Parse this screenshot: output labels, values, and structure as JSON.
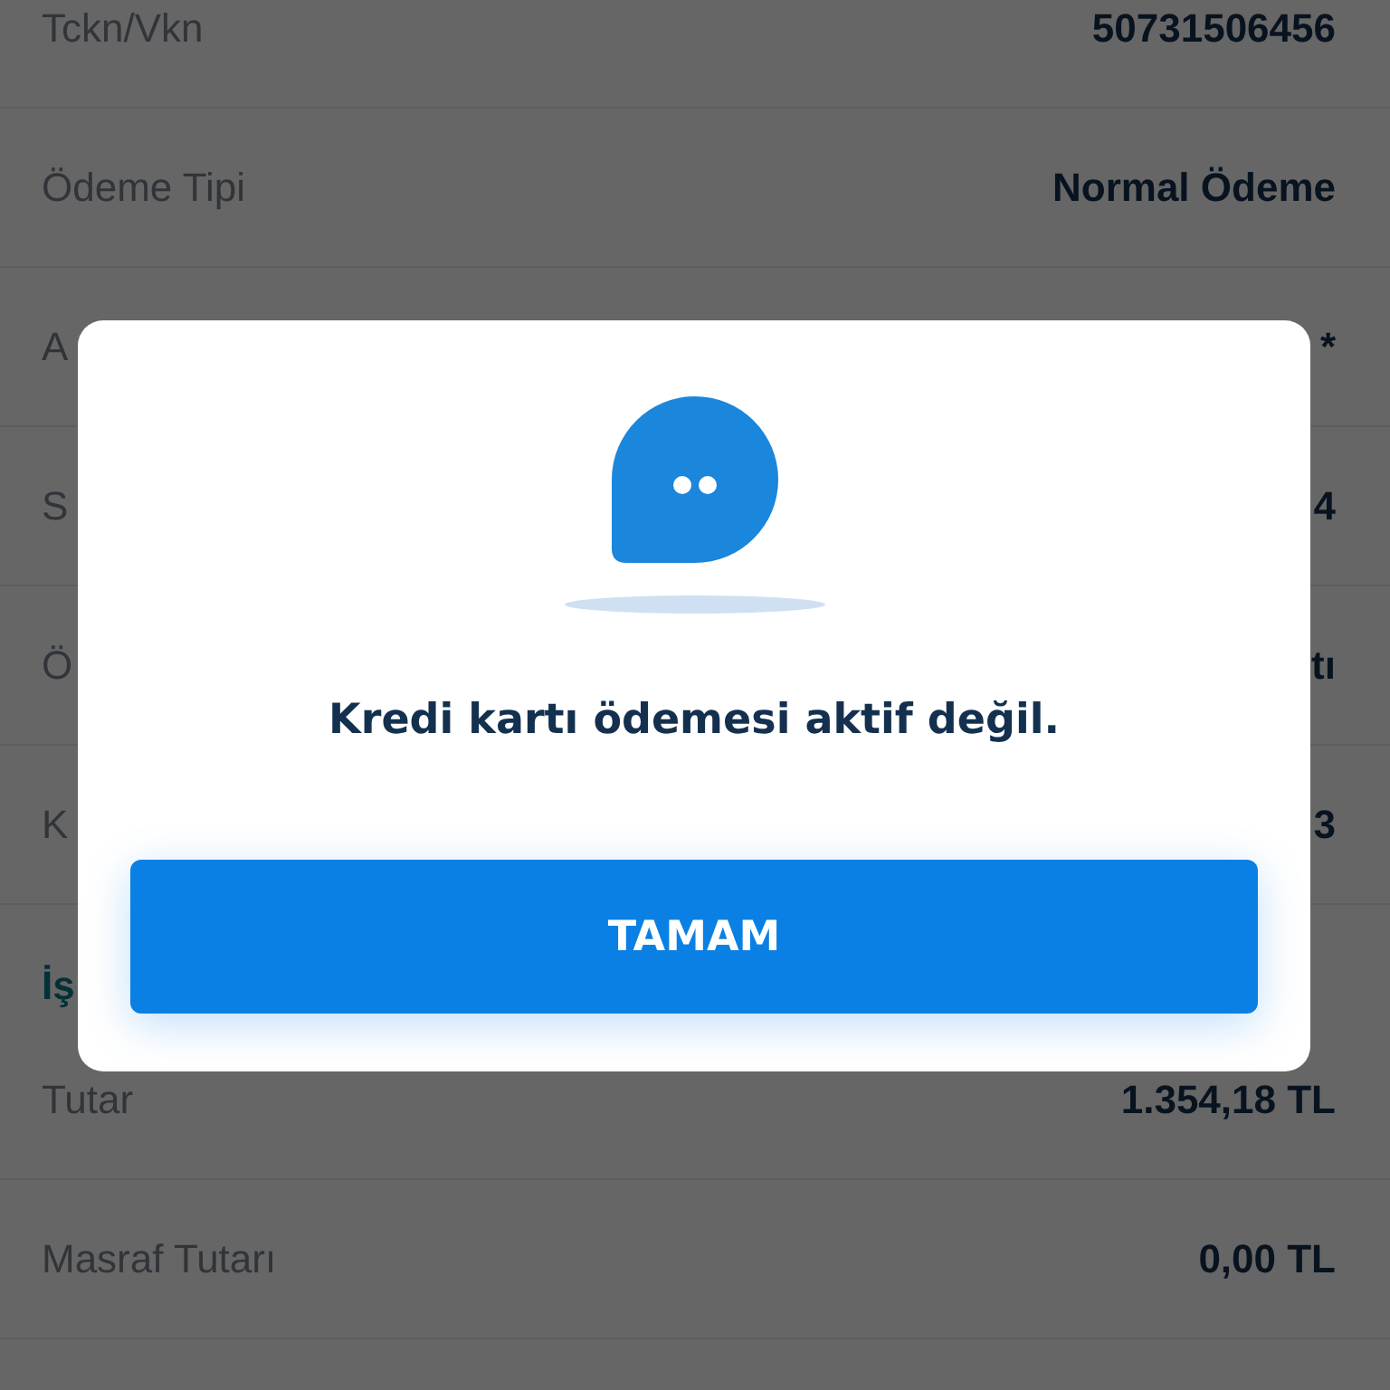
{
  "details": [
    {
      "label": "Tckn/Vkn",
      "value": "50731506456"
    },
    {
      "label": "Ödeme Tipi",
      "value": "Normal Ödeme"
    },
    {
      "label": "A",
      "value": "*"
    },
    {
      "label": "S",
      "value": "4"
    },
    {
      "label": "Ö",
      "value": "tı"
    },
    {
      "label": "K",
      "value": "3"
    }
  ],
  "section_title": "İş",
  "amounts": [
    {
      "label": "Tutar",
      "value": "1.354,18 TL"
    },
    {
      "label": "Masraf Tutarı",
      "value": "0,00 TL"
    }
  ],
  "dialog": {
    "message": "Kredi kartı ödemesi aktif değil.",
    "button": "TAMAM"
  }
}
